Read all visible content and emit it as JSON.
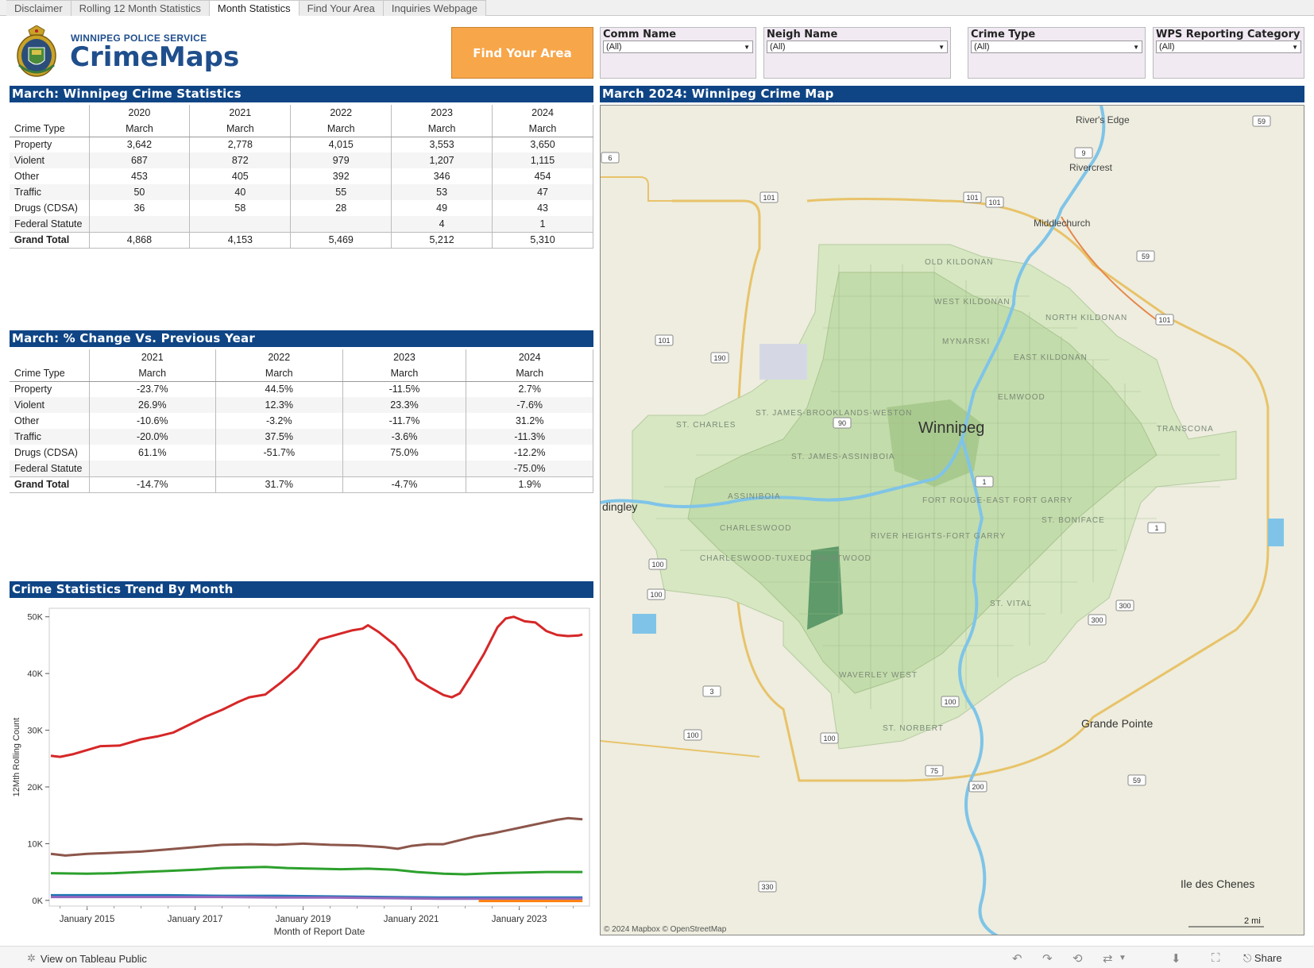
{
  "tabs": [
    {
      "label": "Disclaimer",
      "active": false
    },
    {
      "label": "Rolling 12 Month Statistics",
      "active": false
    },
    {
      "label": "Month Statistics",
      "active": true
    },
    {
      "label": "Find Your Area",
      "active": false
    },
    {
      "label": "Inquiries Webpage",
      "active": false
    }
  ],
  "header": {
    "org": "WINNIPEG POLICE SERVICE",
    "app": "CrimeMaps",
    "find_button": "Find Your Area"
  },
  "filters": [
    {
      "label": "Comm Name",
      "value": "(All)"
    },
    {
      "label": "Neigh Name",
      "value": "(All)"
    },
    {
      "label": "Crime Type",
      "value": "(All)"
    },
    {
      "label": "WPS Reporting Category",
      "value": "(All)"
    }
  ],
  "stats_table": {
    "title": "March: Winnipeg Crime Statistics",
    "row_header": "Crime Type",
    "years": [
      "2020",
      "2021",
      "2022",
      "2023",
      "2024"
    ],
    "month": "March",
    "rows": [
      {
        "type": "Property",
        "values": [
          "3,642",
          "2,778",
          "4,015",
          "3,553",
          "3,650"
        ]
      },
      {
        "type": "Violent",
        "values": [
          "687",
          "872",
          "979",
          "1,207",
          "1,115"
        ]
      },
      {
        "type": "Other",
        "values": [
          "453",
          "405",
          "392",
          "346",
          "454"
        ]
      },
      {
        "type": "Traffic",
        "values": [
          "50",
          "40",
          "55",
          "53",
          "47"
        ]
      },
      {
        "type": "Drugs (CDSA)",
        "values": [
          "36",
          "58",
          "28",
          "49",
          "43"
        ]
      },
      {
        "type": "Federal Statute",
        "values": [
          "",
          "",
          "",
          "4",
          "1"
        ]
      }
    ],
    "total": {
      "type": "Grand Total",
      "values": [
        "4,868",
        "4,153",
        "5,469",
        "5,212",
        "5,310"
      ]
    }
  },
  "change_table": {
    "title": "March: % Change Vs. Previous Year",
    "row_header": "Crime Type",
    "years": [
      "2021",
      "2022",
      "2023",
      "2024"
    ],
    "month": "March",
    "rows": [
      {
        "type": "Property",
        "values": [
          "-23.7%",
          "44.5%",
          "-11.5%",
          "2.7%"
        ]
      },
      {
        "type": "Violent",
        "values": [
          "26.9%",
          "12.3%",
          "23.3%",
          "-7.6%"
        ]
      },
      {
        "type": "Other",
        "values": [
          "-10.6%",
          "-3.2%",
          "-11.7%",
          "31.2%"
        ]
      },
      {
        "type": "Traffic",
        "values": [
          "-20.0%",
          "37.5%",
          "-3.6%",
          "-11.3%"
        ]
      },
      {
        "type": "Drugs (CDSA)",
        "values": [
          "61.1%",
          "-51.7%",
          "75.0%",
          "-12.2%"
        ]
      },
      {
        "type": "Federal Statute",
        "values": [
          "",
          "",
          "",
          "-75.0%"
        ]
      }
    ],
    "total": {
      "type": "Grand Total",
      "values": [
        "-14.7%",
        "31.7%",
        "-4.7%",
        "1.9%"
      ]
    }
  },
  "trend": {
    "title": "Crime Statistics Trend By Month"
  },
  "chart_data": {
    "type": "line",
    "title": "Crime Statistics Trend By Month",
    "xlabel": "Month of Report Date",
    "ylabel": "12Mth Rolling Count",
    "xlim": [
      2014.3,
      2024.3
    ],
    "ylim": [
      -1000,
      51500
    ],
    "x_ticks": [
      {
        "v": 2015,
        "label": "January 2015"
      },
      {
        "v": 2017,
        "label": "January 2017"
      },
      {
        "v": 2019,
        "label": "January 2019"
      },
      {
        "v": 2021,
        "label": "January 2021"
      },
      {
        "v": 2023,
        "label": "January 2023"
      }
    ],
    "y_ticks": [
      {
        "v": 0,
        "label": "0K"
      },
      {
        "v": 10000,
        "label": "10K"
      },
      {
        "v": 20000,
        "label": "20K"
      },
      {
        "v": 30000,
        "label": "30K"
      },
      {
        "v": 40000,
        "label": "40K"
      },
      {
        "v": 50000,
        "label": "50K"
      }
    ],
    "series": [
      {
        "color": "#d62728",
        "points": [
          [
            2014.33,
            25500
          ],
          [
            2014.5,
            25300
          ],
          [
            2014.75,
            25800
          ],
          [
            2015.0,
            26500
          ],
          [
            2015.25,
            27200
          ],
          [
            2015.6,
            27300
          ],
          [
            2016.0,
            28400
          ],
          [
            2016.3,
            28900
          ],
          [
            2016.6,
            29600
          ],
          [
            2016.9,
            31000
          ],
          [
            2017.2,
            32400
          ],
          [
            2017.5,
            33600
          ],
          [
            2017.8,
            35000
          ],
          [
            2018.0,
            35800
          ],
          [
            2018.3,
            36300
          ],
          [
            2018.6,
            38500
          ],
          [
            2018.9,
            41000
          ],
          [
            2019.1,
            43500
          ],
          [
            2019.3,
            46000
          ],
          [
            2019.6,
            46800
          ],
          [
            2019.9,
            47600
          ],
          [
            2020.1,
            47900
          ],
          [
            2020.2,
            48500
          ],
          [
            2020.4,
            47300
          ],
          [
            2020.7,
            45000
          ],
          [
            2020.9,
            42500
          ],
          [
            2021.1,
            39000
          ],
          [
            2021.35,
            37500
          ],
          [
            2021.6,
            36200
          ],
          [
            2021.75,
            35800
          ],
          [
            2021.9,
            36500
          ],
          [
            2022.1,
            39500
          ],
          [
            2022.35,
            43500
          ],
          [
            2022.6,
            48200
          ],
          [
            2022.75,
            49700
          ],
          [
            2022.9,
            50000
          ],
          [
            2023.1,
            49200
          ],
          [
            2023.3,
            49000
          ],
          [
            2023.5,
            47500
          ],
          [
            2023.7,
            46800
          ],
          [
            2023.9,
            46600
          ],
          [
            2024.1,
            46700
          ],
          [
            2024.17,
            46900
          ]
        ]
      },
      {
        "color": "#8c564b",
        "points": [
          [
            2014.33,
            8200
          ],
          [
            2014.6,
            7900
          ],
          [
            2015.0,
            8200
          ],
          [
            2015.5,
            8400
          ],
          [
            2016.0,
            8600
          ],
          [
            2016.5,
            9000
          ],
          [
            2017.0,
            9400
          ],
          [
            2017.5,
            9800
          ],
          [
            2018.0,
            9900
          ],
          [
            2018.5,
            9800
          ],
          [
            2019.0,
            10000
          ],
          [
            2019.5,
            9800
          ],
          [
            2020.0,
            9700
          ],
          [
            2020.5,
            9400
          ],
          [
            2020.75,
            9100
          ],
          [
            2021.0,
            9600
          ],
          [
            2021.3,
            9900
          ],
          [
            2021.6,
            9900
          ],
          [
            2021.9,
            10600
          ],
          [
            2022.2,
            11300
          ],
          [
            2022.5,
            11800
          ],
          [
            2022.8,
            12400
          ],
          [
            2023.1,
            13000
          ],
          [
            2023.4,
            13600
          ],
          [
            2023.7,
            14200
          ],
          [
            2023.9,
            14500
          ],
          [
            2024.17,
            14300
          ]
        ]
      },
      {
        "color": "#2ca02c",
        "points": [
          [
            2014.33,
            4800
          ],
          [
            2015.0,
            4700
          ],
          [
            2015.5,
            4800
          ],
          [
            2016.0,
            5000
          ],
          [
            2016.5,
            5200
          ],
          [
            2017.0,
            5400
          ],
          [
            2017.5,
            5700
          ],
          [
            2017.9,
            5800
          ],
          [
            2018.3,
            5900
          ],
          [
            2018.7,
            5700
          ],
          [
            2019.2,
            5600
          ],
          [
            2019.7,
            5500
          ],
          [
            2020.2,
            5600
          ],
          [
            2020.7,
            5400
          ],
          [
            2021.1,
            5000
          ],
          [
            2021.6,
            4700
          ],
          [
            2022.0,
            4600
          ],
          [
            2022.5,
            4800
          ],
          [
            2023.0,
            4900
          ],
          [
            2023.5,
            5000
          ],
          [
            2024.17,
            5000
          ]
        ]
      },
      {
        "color": "#1f77b4",
        "points": [
          [
            2014.33,
            900
          ],
          [
            2015.5,
            900
          ],
          [
            2016.5,
            900
          ],
          [
            2017.5,
            800
          ],
          [
            2018.5,
            800
          ],
          [
            2019.5,
            700
          ],
          [
            2020.5,
            600
          ],
          [
            2021.5,
            500
          ],
          [
            2022.5,
            500
          ],
          [
            2023.5,
            500
          ],
          [
            2024.17,
            500
          ]
        ]
      },
      {
        "color": "#9467bd",
        "points": [
          [
            2014.33,
            600
          ],
          [
            2015.5,
            600
          ],
          [
            2016.5,
            600
          ],
          [
            2017.5,
            600
          ],
          [
            2018.5,
            500
          ],
          [
            2019.5,
            500
          ],
          [
            2020.5,
            400
          ],
          [
            2021.5,
            300
          ],
          [
            2022.5,
            300
          ],
          [
            2023.5,
            300
          ],
          [
            2024.17,
            300
          ]
        ]
      },
      {
        "color": "#ff7f0e",
        "points": [
          [
            2022.25,
            -100
          ],
          [
            2023.0,
            -100
          ],
          [
            2024.17,
            -100
          ]
        ]
      }
    ]
  },
  "map": {
    "title": "March 2024:  Winnipeg Crime Map",
    "attribution": "© 2024 Mapbox  © OpenStreetMap",
    "scale": "2 mi",
    "places": [
      {
        "name": "River's Edge"
      },
      {
        "name": "Rivercrest"
      },
      {
        "name": "Middlechurch"
      },
      {
        "name": "Winnipeg"
      },
      {
        "name": "dingley"
      },
      {
        "name": "Grande Pointe"
      },
      {
        "name": "Ile des Chenes"
      }
    ],
    "neighbourhoods": [
      "OLD KILDONAN",
      "WEST KILDONAN",
      "NORTH KILDONAN",
      "MYNARSKI",
      "EAST KILDONAN",
      "ELMWOOD",
      "ST. CHARLES",
      "ST. JAMES-BROOKLANDS-WESTON",
      "TRANSCONA",
      "ST. JAMES-ASSINIBOIA",
      "ASSINIBOIA",
      "FORT ROUGE-EAST FORT GARRY",
      "ST. BONIFACE",
      "CHARLESWOOD",
      "RIVER HEIGHTS-FORT GARRY",
      "CHARLESWOOD-TUXEDO-WESTWOOD",
      "ST. VITAL",
      "WAVERLEY WEST",
      "ST. NORBERT"
    ],
    "shields": [
      "59",
      "9",
      "6",
      "101",
      "101",
      "101",
      "59",
      "101",
      "101",
      "190",
      "90",
      "1",
      "1",
      "100",
      "100",
      "300",
      "300",
      "3",
      "100",
      "100",
      "100",
      "75",
      "200",
      "59",
      "330"
    ]
  },
  "footer": {
    "tableau_link": "View on Tableau Public",
    "share": "Share"
  }
}
